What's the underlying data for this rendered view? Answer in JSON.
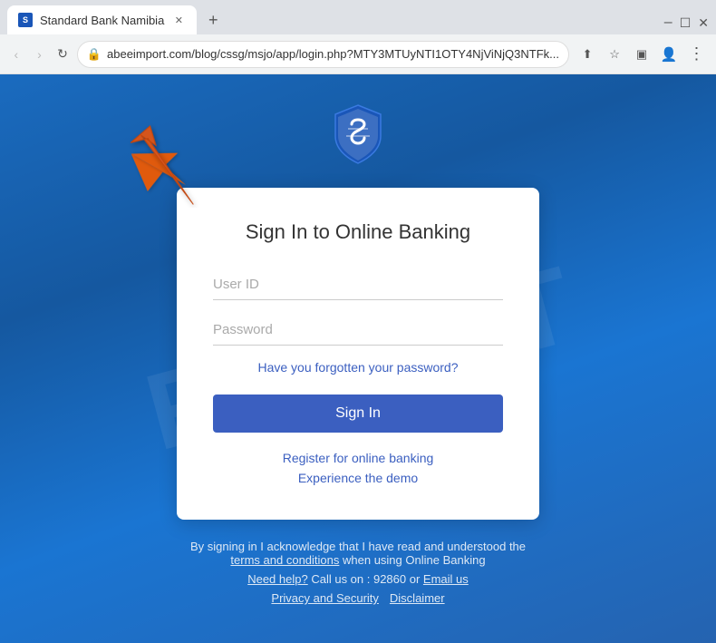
{
  "browser": {
    "tab_title": "Standard Bank Namibia",
    "tab_favicon": "SB",
    "url": "abeeimport.com/blog/cssg/msjo/app/login.php?MTY3MTUyNTI1OTY4NjViNjQ3NTFk...",
    "nav": {
      "back": "‹",
      "forward": "›",
      "refresh": "↻"
    }
  },
  "page": {
    "logo_alt": "Standard Bank Shield Logo",
    "title": "Sign In to Online Banking",
    "userid_placeholder": "User ID",
    "password_placeholder": "Password",
    "forgot_label": "Have you forgotten your password?",
    "signin_label": "Sign In",
    "register_label": "Register for online banking",
    "demo_label": "Experience the demo",
    "footer_text1": "By signing in I acknowledge that I have read and understood the",
    "footer_text2": "terms and conditions",
    "footer_text3": "when using Online Banking",
    "help_label": "Need help?",
    "call_label": "Call us on : 92860 or",
    "email_label": "Email us",
    "privacy_label": "Privacy and Security",
    "disclaimer_label": "Disclaimer"
  }
}
